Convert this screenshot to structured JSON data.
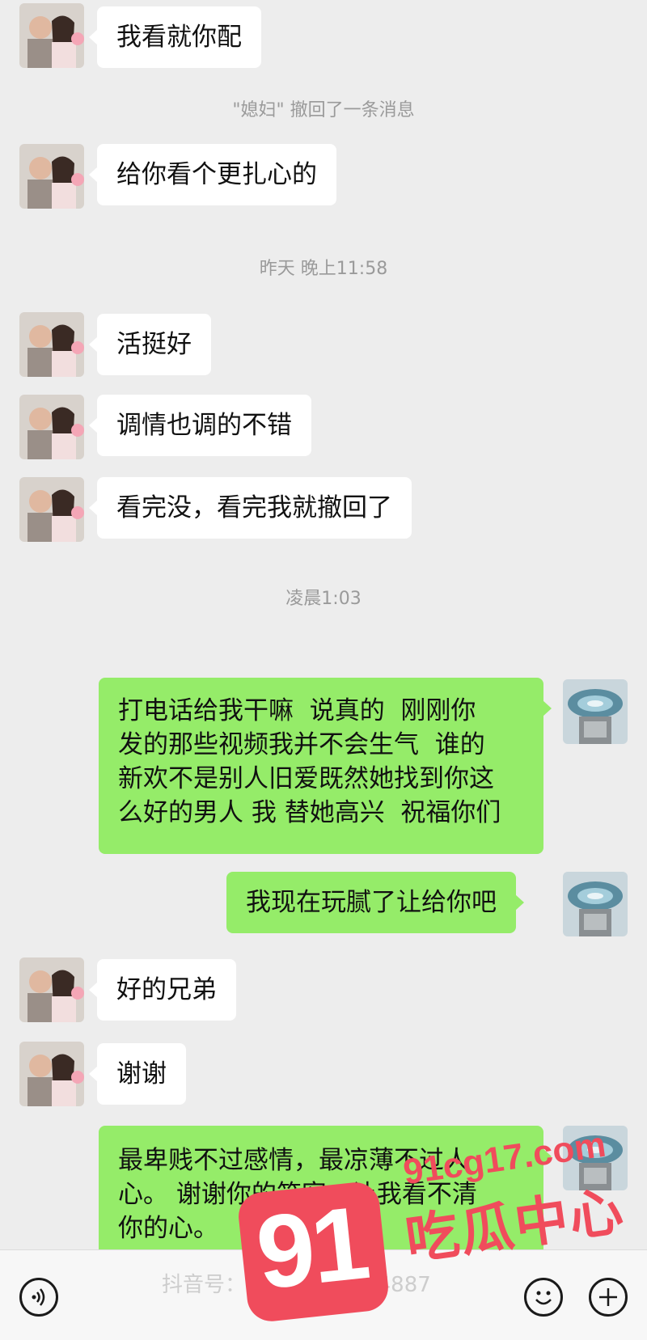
{
  "system_notices": {
    "recall_notice": "\"媳妇\" 撤回了一条消息",
    "timestamp_1": "昨天 晚上11:58",
    "timestamp_2": "凌晨1:03"
  },
  "messages": [
    {
      "side": "in",
      "text": "我看就你配"
    },
    {
      "side": "in",
      "text": "给你看个更扎心的"
    },
    {
      "side": "in",
      "text": "活挺好"
    },
    {
      "side": "in",
      "text": "调情也调的不错"
    },
    {
      "side": "in",
      "text": "看完没，看完我就撤回了"
    },
    {
      "side": "out",
      "text": "打电话给我干嘛  说真的  刚刚你\n发的那些视频我并不会生气  谁的\n新欢不是别人旧爱既然她找到你这\n么好的男人 我 替她高兴  祝福你们"
    },
    {
      "side": "out",
      "text": "我现在玩腻了让给你吧"
    },
    {
      "side": "in",
      "text": "好的兄弟"
    },
    {
      "side": "in",
      "text": "谢谢"
    },
    {
      "side": "out",
      "text": "最卑贱不过感情，最凉薄不过人\n心。 谢谢你的笑容，让我看不清\n你的心。"
    }
  ],
  "bottom_bar": {
    "voice_icon": "voice-icon",
    "emoji_icon": "emoji-icon",
    "plus_icon": "plus-icon"
  },
  "watermark": {
    "douyin_text": "抖音号：liang2474004887",
    "logo_number": "91",
    "logo_url": "91cg17.com",
    "logo_name": "吃瓜中心"
  },
  "colors": {
    "background": "#ededed",
    "incoming_bubble": "#ffffff",
    "outgoing_bubble": "#95ec69",
    "logo_accent": "#f04c5c"
  }
}
